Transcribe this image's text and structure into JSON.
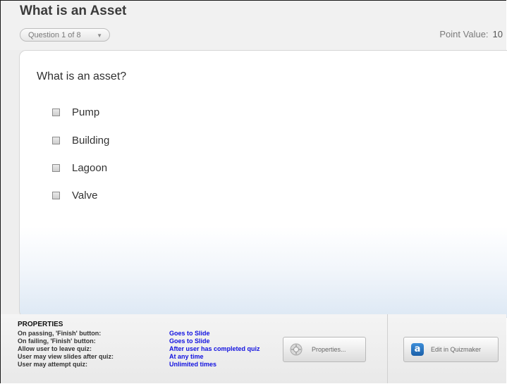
{
  "quiz": {
    "title": "What is an Asset",
    "question_selector": "Question 1 of 8",
    "point_value_label": "Point Value:",
    "point_value": "10"
  },
  "question": {
    "text": "What is an asset?",
    "choices": [
      "Pump",
      "Building",
      "Lagoon",
      "Valve"
    ]
  },
  "properties": {
    "heading": "PROPERTIES",
    "rows": [
      {
        "label": "On passing, 'Finish' button:",
        "value": "Goes to Slide"
      },
      {
        "label": "On failing, 'Finish' button:",
        "value": "Goes to Slide"
      },
      {
        "label": "Allow user to leave quiz:",
        "value": "After user has completed quiz"
      },
      {
        "label": "User may view slides after quiz:",
        "value": "At any time"
      },
      {
        "label": "User may attempt quiz:",
        "value": "Unlimited times"
      }
    ],
    "properties_button": "Properties...",
    "edit_button": "Edit in Quizmaker"
  },
  "icons": {
    "selector_arrow": "chevron-down-icon",
    "properties_button_icon": "gear-icon",
    "edit_button_icon": "quizmaker-a-icon"
  },
  "colors": {
    "value_text": "#1010e0",
    "title_text": "#3b3b3b"
  }
}
